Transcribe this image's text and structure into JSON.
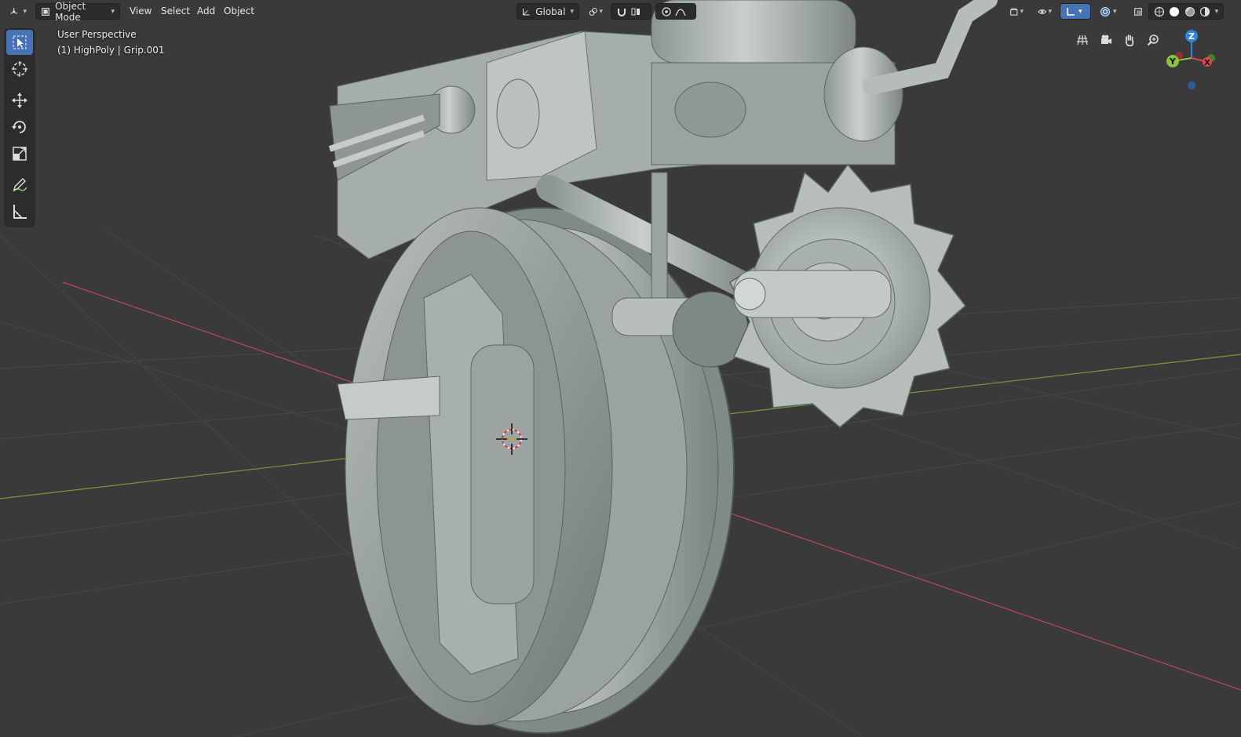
{
  "header": {
    "editor_type_icon": "view3d-editor-icon",
    "mode_label": "Object Mode",
    "menus": [
      "View",
      "Select",
      "Add",
      "Object"
    ],
    "transform_orientation": "Global",
    "pivot_icon": "pivot-point-icon",
    "snap_icon": "snap-magnet-icon",
    "proportional_icon": "proportional-edit-icon",
    "right_icons": [
      "object-type-visibility-icon",
      "show-gizmo-icon",
      "overlays-icon",
      "xray-icon",
      "wireframe-shading-icon",
      "solid-shading-icon",
      "material-preview-icon",
      "rendered-shading-icon"
    ]
  },
  "toolbar": {
    "tools": [
      "select-box-icon",
      "cursor-icon",
      "move-icon",
      "rotate-icon",
      "scale-icon",
      "annotate-icon",
      "measure-icon"
    ],
    "active_tool": "select-box-icon"
  },
  "viewport": {
    "view_name": "User Perspective",
    "object_info": "(1) HighPoly | Grip.001",
    "background": "#3a3a3a",
    "grid_color": "#474747",
    "x_axis_color": "#b84a55",
    "y_axis_color": "#7a9a3a"
  },
  "navigation": {
    "buttons": [
      "toggle-camera-grid-icon",
      "camera-view-icon",
      "pan-hand-icon",
      "zoom-icon"
    ],
    "axes": {
      "x": "X",
      "y": "Y",
      "z": "Z"
    },
    "axis_colors": {
      "x": "#e04452",
      "y": "#8bc23a",
      "z": "#2f84e3"
    }
  }
}
